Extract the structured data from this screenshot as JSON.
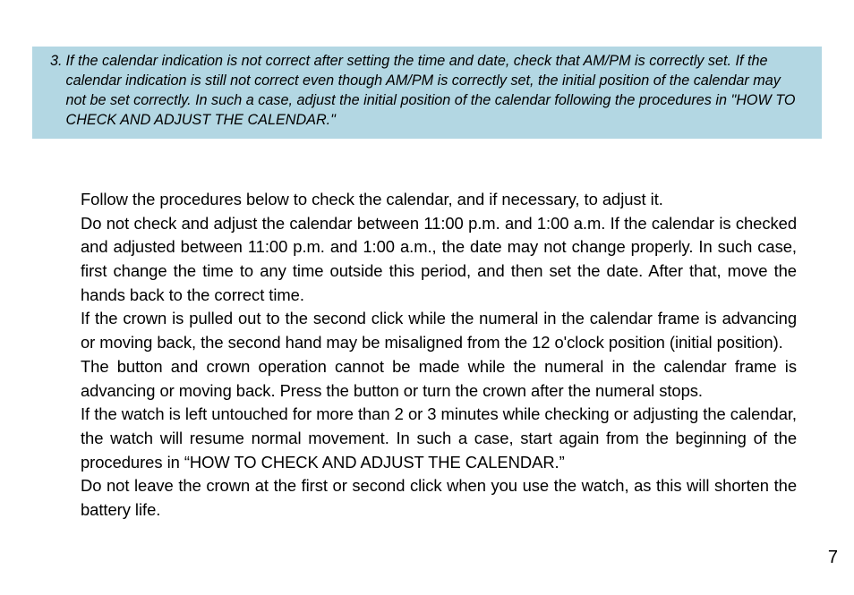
{
  "note": {
    "number": "3.",
    "text": "If the calendar indication is not correct after setting the time and date, check that AM/PM is correctly set. If the calendar indication is still not correct even though AM/PM is correctly set, the initial position of the calendar may not be set correctly. In such a case, adjust the initial position of the calendar following the procedures in \"HOW TO CHECK AND ADJUST THE CALENDAR.\""
  },
  "body": {
    "p1": "Follow the procedures below to check the calendar, and if necessary, to adjust it.",
    "p2": "Do not check and adjust the calendar between 11:00 p.m. and 1:00 a.m. If the calendar is checked and adjusted between 11:00 p.m. and 1:00 a.m., the date may not change properly.  In such case, first change the time to any time outside this period, and then set the date.   After that, move the hands back to the correct time.",
    "p3": "If the crown is pulled out to the second click while the numeral in the calendar frame is advancing or moving back, the second hand may be misaligned from the 12 o'clock position (initial position).",
    "p4": "The button and crown operation cannot be made while the numeral in the calendar frame is advancing or moving back.  Press the button or turn the crown after the numeral stops.",
    "p5": "If  the watch is left untouched for more than 2 or 3 minutes while checking or adjusting the calendar, the watch will resume normal movement.   In such a case, start again from the beginning of the procedures in “HOW TO CHECK AND ADJUST THE CALENDAR.”",
    "p6": "Do not leave the crown at the first or second click when you use the watch, as this will shorten the battery life."
  },
  "page_number": "7"
}
